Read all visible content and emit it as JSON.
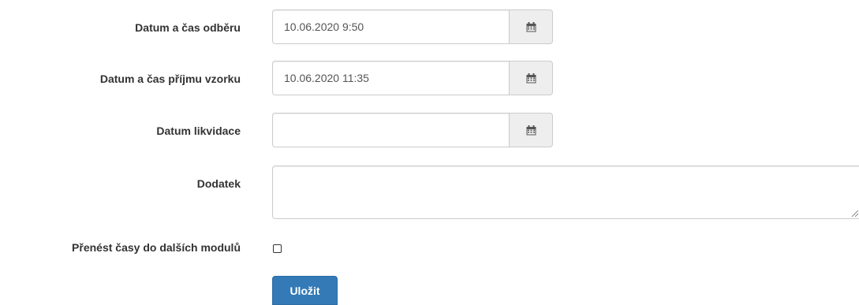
{
  "form": {
    "fields": [
      {
        "label": "Datum a čas odběru",
        "value": "10.06.2020 9:50",
        "icon": "calendar-icon"
      },
      {
        "label": "Datum a čas příjmu vzorku",
        "value": "10.06.2020 11:35",
        "icon": "calendar-icon"
      },
      {
        "label": "Datum likvidace",
        "value": "",
        "icon": "calendar-icon"
      }
    ],
    "addendum": {
      "label": "Dodatek",
      "value": ""
    },
    "transfer_times": {
      "label": "Přenést časy do dalších modulů",
      "checked": false
    },
    "save_button": {
      "label": "Uložit"
    }
  },
  "colors": {
    "primary": "#337ab7",
    "border": "#cccccc",
    "addon_bg": "#eeeeee",
    "text": "#333333"
  }
}
